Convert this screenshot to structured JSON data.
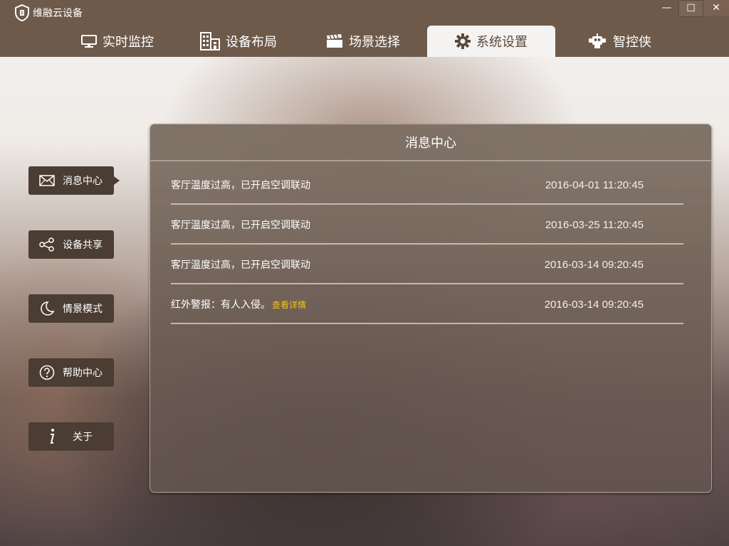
{
  "app": {
    "name": "维融云设备"
  },
  "window_controls": {
    "minimize": "—",
    "maximize": "☐",
    "close": "✕"
  },
  "tabs": [
    {
      "label": "实时监控",
      "icon": "monitor-icon"
    },
    {
      "label": "设备布局",
      "icon": "building-icon"
    },
    {
      "label": "场景选择",
      "icon": "clapperboard-icon"
    },
    {
      "label": "系统设置",
      "icon": "gear-icon",
      "active": true
    },
    {
      "label": "智控侠",
      "icon": "robot-icon"
    }
  ],
  "sidebar": {
    "items": [
      {
        "label": "消息中心",
        "icon": "mail-icon",
        "active": true
      },
      {
        "label": "设备共享",
        "icon": "share-icon"
      },
      {
        "label": "情景模式",
        "icon": "moon-icon"
      },
      {
        "label": "帮助中心",
        "icon": "question-icon"
      },
      {
        "label": "关于",
        "icon": "info-icon"
      }
    ]
  },
  "panel": {
    "title": "消息中心",
    "messages": [
      {
        "text": "客厅温度过高，已开启空调联动",
        "link": "",
        "time": "2016-04-01  11:20:45"
      },
      {
        "text": "客厅温度过高，已开启空调联动",
        "link": "",
        "time": "2016-03-25  11:20:45"
      },
      {
        "text": "客厅温度过高，已开启空调联动",
        "link": "",
        "time": "2016-03-14  09:20:45"
      },
      {
        "text": "红外警报：有人入侵。",
        "link": "查看详情",
        "time": "2016-03-14  09:20:45"
      }
    ]
  },
  "colors": {
    "titlebar": "#6e5a4b",
    "sidebar_item": "#4b3d33",
    "link": "#f2c31a"
  }
}
